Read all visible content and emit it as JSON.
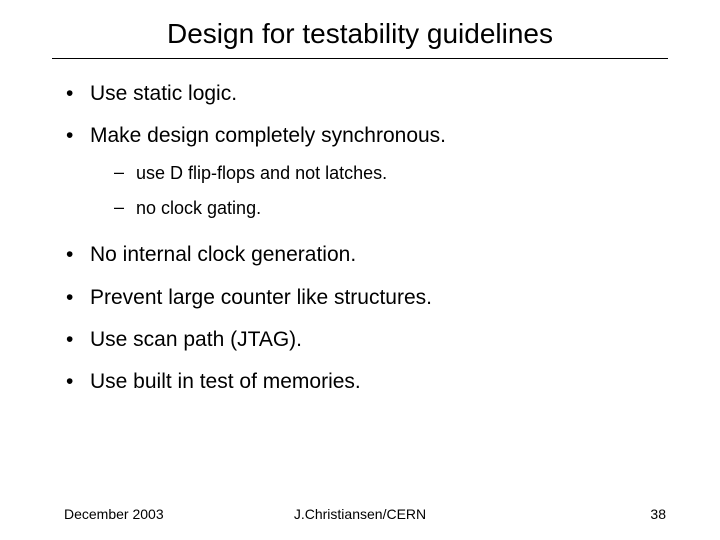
{
  "title": "Design for testability guidelines",
  "bullets": [
    {
      "text": "Use static logic."
    },
    {
      "text": "Make design completely synchronous.",
      "sub": [
        "use D flip-flops and not latches.",
        "no clock gating."
      ]
    },
    {
      "text": "No internal clock generation."
    },
    {
      "text": "Prevent large counter like structures."
    },
    {
      "text": "Use scan path (JTAG)."
    },
    {
      "text": "Use built in test of memories."
    }
  ],
  "footer": {
    "left": "December 2003",
    "center": "J.Christiansen/CERN",
    "right": "38"
  }
}
